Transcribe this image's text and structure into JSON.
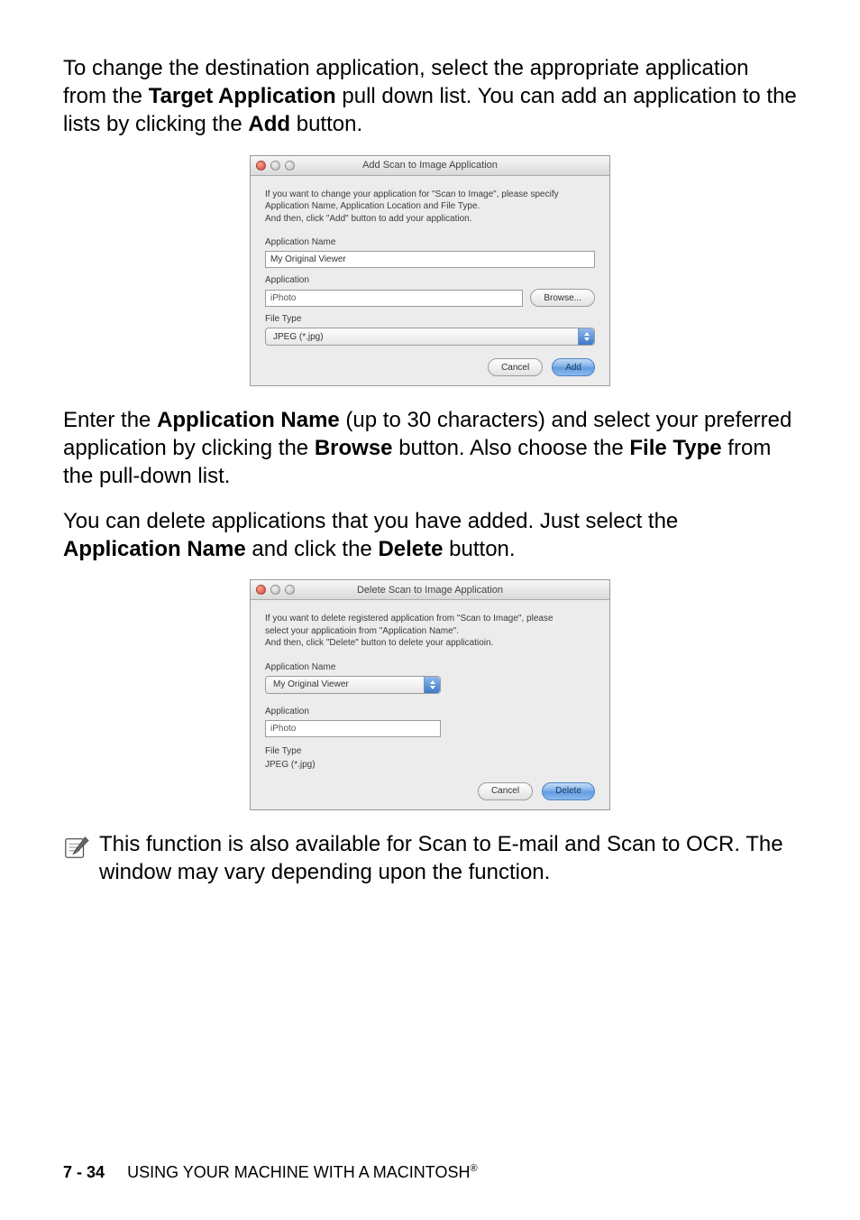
{
  "para1_before": "To change the destination application, select the appropriate application from the ",
  "para1_bold1": "Target Application",
  "para1_mid": " pull down list. You can add an application to the lists by clicking the ",
  "para1_bold2": "Add",
  "para1_after": " button.",
  "add_dialog": {
    "title": "Add Scan to Image Application",
    "instructions": "If you want to change your application for \"Scan to Image\", please specify\nApplication Name, Application Location and File Type.\nAnd then, click \"Add\" button to add your application.",
    "app_name_label": "Application Name",
    "app_name_value": "My Original Viewer",
    "application_label": "Application",
    "application_value": "iPhoto",
    "browse_label": "Browse...",
    "file_type_label": "File Type",
    "file_type_value": "JPEG (*.jpg)",
    "cancel_label": "Cancel",
    "add_label": "Add"
  },
  "para2_before": "Enter the ",
  "para2_bold1": "Application Name",
  "para2_mid1": " (up to 30 characters) and select your preferred application by clicking the ",
  "para2_bold2": "Browse",
  "para2_mid2": " button. Also choose the ",
  "para2_bold3": "File Type",
  "para2_after": " from the pull-down list.",
  "para3_before": "You can delete applications that you have added. Just select the ",
  "para3_bold1": "Application Name",
  "para3_mid": " and click the ",
  "para3_bold2": "Delete",
  "para3_after": " button.",
  "del_dialog": {
    "title": "Delete Scan to Image Application",
    "instructions": "If you want to delete registered application from \"Scan to Image\", please\nselect your applicatioin from \"Application Name\".\nAnd then, click \"Delete\" button to delete your applicatioin.",
    "app_name_label": "Application Name",
    "app_name_value": "My Original Viewer",
    "application_label": "Application",
    "application_value": "iPhoto",
    "file_type_label": "File Type",
    "file_type_value": "JPEG (*.jpg)",
    "cancel_label": "Cancel",
    "delete_label": "Delete"
  },
  "note_text": "This function is also available for Scan to E-mail and Scan to OCR. The window may vary depending upon the function.",
  "footer_page": "7 - 34",
  "footer_text": "USING YOUR MACHINE WITH A MACINTOSH",
  "footer_reg": "®"
}
